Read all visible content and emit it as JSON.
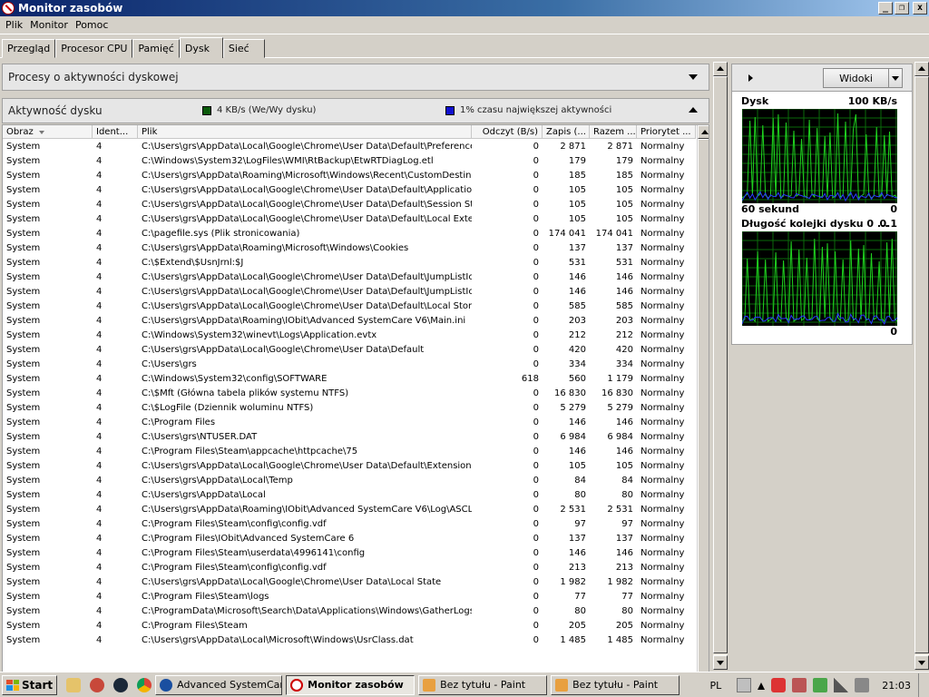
{
  "window": {
    "title": "Monitor zasobów",
    "controls": [
      "_",
      "❐",
      "x"
    ]
  },
  "menu": [
    "Plik",
    "Monitor",
    "Pomoc"
  ],
  "tabs": [
    {
      "label": "Przegląd",
      "active": false
    },
    {
      "label": "Procesor CPU",
      "active": false
    },
    {
      "label": "Pamięć",
      "active": false
    },
    {
      "label": "Dysk",
      "active": true
    },
    {
      "label": "Sieć",
      "active": false
    }
  ],
  "sections": {
    "processes": {
      "title": "Procesy o aktywności dyskowej"
    },
    "disk_activity": {
      "title": "Aktywność dysku",
      "legend_rw": {
        "text": "4 KB/s (We/Wy dysku)",
        "color": "#0a5a0a"
      },
      "legend_active": {
        "text": "1% czasu największej aktywności",
        "color": "#1010d0"
      }
    }
  },
  "table": {
    "columns": [
      "Obraz",
      "Ident...",
      "Plik",
      "Odczyt (B/s)",
      "Zapis (...",
      "Razem ...",
      "Priorytet ..."
    ],
    "rows": [
      [
        "System",
        "4",
        "C:\\Users\\grs\\AppData\\Local\\Google\\Chrome\\User Data\\Default\\Preferences",
        "0",
        "2 871",
        "2 871",
        "Normalny"
      ],
      [
        "System",
        "4",
        "C:\\Windows\\System32\\LogFiles\\WMI\\RtBackup\\EtwRTDiagLog.etl",
        "0",
        "179",
        "179",
        "Normalny"
      ],
      [
        "System",
        "4",
        "C:\\Users\\grs\\AppData\\Roaming\\Microsoft\\Windows\\Recent\\CustomDestinati...",
        "0",
        "185",
        "185",
        "Normalny"
      ],
      [
        "System",
        "4",
        "C:\\Users\\grs\\AppData\\Local\\Google\\Chrome\\User Data\\Default\\Application ...",
        "0",
        "105",
        "105",
        "Normalny"
      ],
      [
        "System",
        "4",
        "C:\\Users\\grs\\AppData\\Local\\Google\\Chrome\\User Data\\Default\\Session Stor...",
        "0",
        "105",
        "105",
        "Normalny"
      ],
      [
        "System",
        "4",
        "C:\\Users\\grs\\AppData\\Local\\Google\\Chrome\\User Data\\Default\\Local Extensi...",
        "0",
        "105",
        "105",
        "Normalny"
      ],
      [
        "System",
        "4",
        "C:\\pagefile.sys (Plik stronicowania)",
        "0",
        "174 041",
        "174 041",
        "Normalny"
      ],
      [
        "System",
        "4",
        "C:\\Users\\grs\\AppData\\Roaming\\Microsoft\\Windows\\Cookies",
        "0",
        "137",
        "137",
        "Normalny"
      ],
      [
        "System",
        "4",
        "C:\\$Extend\\$UsnJrnl:$J",
        "0",
        "531",
        "531",
        "Normalny"
      ],
      [
        "System",
        "4",
        "C:\\Users\\grs\\AppData\\Local\\Google\\Chrome\\User Data\\Default\\JumpListIcon...",
        "0",
        "146",
        "146",
        "Normalny"
      ],
      [
        "System",
        "4",
        "C:\\Users\\grs\\AppData\\Local\\Google\\Chrome\\User Data\\Default\\JumpListIcons",
        "0",
        "146",
        "146",
        "Normalny"
      ],
      [
        "System",
        "4",
        "C:\\Users\\grs\\AppData\\Local\\Google\\Chrome\\User Data\\Default\\Local Storage",
        "0",
        "585",
        "585",
        "Normalny"
      ],
      [
        "System",
        "4",
        "C:\\Users\\grs\\AppData\\Roaming\\IObit\\Advanced SystemCare V6\\Main.ini",
        "0",
        "203",
        "203",
        "Normalny"
      ],
      [
        "System",
        "4",
        "C:\\Windows\\System32\\winevt\\Logs\\Application.evtx",
        "0",
        "212",
        "212",
        "Normalny"
      ],
      [
        "System",
        "4",
        "C:\\Users\\grs\\AppData\\Local\\Google\\Chrome\\User Data\\Default",
        "0",
        "420",
        "420",
        "Normalny"
      ],
      [
        "System",
        "4",
        "C:\\Users\\grs",
        "0",
        "334",
        "334",
        "Normalny"
      ],
      [
        "System",
        "4",
        "C:\\Windows\\System32\\config\\SOFTWARE",
        "618",
        "560",
        "1 179",
        "Normalny"
      ],
      [
        "System",
        "4",
        "C:\\$Mft (Główna tabela plików systemu NTFS)",
        "0",
        "16 830",
        "16 830",
        "Normalny"
      ],
      [
        "System",
        "4",
        "C:\\$LogFile (Dziennik woluminu NTFS)",
        "0",
        "5 279",
        "5 279",
        "Normalny"
      ],
      [
        "System",
        "4",
        "C:\\Program Files",
        "0",
        "146",
        "146",
        "Normalny"
      ],
      [
        "System",
        "4",
        "C:\\Users\\grs\\NTUSER.DAT",
        "0",
        "6 984",
        "6 984",
        "Normalny"
      ],
      [
        "System",
        "4",
        "C:\\Program Files\\Steam\\appcache\\httpcache\\75",
        "0",
        "146",
        "146",
        "Normalny"
      ],
      [
        "System",
        "4",
        "C:\\Users\\grs\\AppData\\Local\\Google\\Chrome\\User Data\\Default\\Extension State",
        "0",
        "105",
        "105",
        "Normalny"
      ],
      [
        "System",
        "4",
        "C:\\Users\\grs\\AppData\\Local\\Temp",
        "0",
        "84",
        "84",
        "Normalny"
      ],
      [
        "System",
        "4",
        "C:\\Users\\grs\\AppData\\Local",
        "0",
        "80",
        "80",
        "Normalny"
      ],
      [
        "System",
        "4",
        "C:\\Users\\grs\\AppData\\Roaming\\IObit\\Advanced SystemCare V6\\Log\\ASCLo...",
        "0",
        "2 531",
        "2 531",
        "Normalny"
      ],
      [
        "System",
        "4",
        "C:\\Program Files\\Steam\\config\\config.vdf",
        "0",
        "97",
        "97",
        "Normalny"
      ],
      [
        "System",
        "4",
        "C:\\Program Files\\IObit\\Advanced SystemCare 6",
        "0",
        "137",
        "137",
        "Normalny"
      ],
      [
        "System",
        "4",
        "C:\\Program Files\\Steam\\userdata\\4996141\\config",
        "0",
        "146",
        "146",
        "Normalny"
      ],
      [
        "System",
        "4",
        "C:\\Program Files\\Steam\\config\\config.vdf",
        "0",
        "213",
        "213",
        "Normalny"
      ],
      [
        "System",
        "4",
        "C:\\Users\\grs\\AppData\\Local\\Google\\Chrome\\User Data\\Local State",
        "0",
        "1 982",
        "1 982",
        "Normalny"
      ],
      [
        "System",
        "4",
        "C:\\Program Files\\Steam\\logs",
        "0",
        "77",
        "77",
        "Normalny"
      ],
      [
        "System",
        "4",
        "C:\\ProgramData\\Microsoft\\Search\\Data\\Applications\\Windows\\GatherLogs\\S...",
        "0",
        "80",
        "80",
        "Normalny"
      ],
      [
        "System",
        "4",
        "C:\\Program Files\\Steam",
        "0",
        "205",
        "205",
        "Normalny"
      ],
      [
        "System",
        "4",
        "C:\\Users\\grs\\AppData\\Local\\Microsoft\\Windows\\UsrClass.dat",
        "0",
        "1 485",
        "1 485",
        "Normalny"
      ]
    ]
  },
  "right_pane": {
    "views_button": "Widoki",
    "graph1": {
      "title": "Dysk",
      "max_label": "100 KB/s",
      "x_label": "60 sekund",
      "min_label": "0"
    },
    "graph2": {
      "title": "Długość kolejki dysku 0 ...",
      "max_label": "0.1",
      "min_label": "0"
    },
    "colors": {
      "background": "#000000",
      "grid": "#0a6a0a",
      "primary": "#1fd21f",
      "secondary": "#2a3aff"
    }
  },
  "taskbar": {
    "start": "Start",
    "buttons": [
      {
        "label": "Advanced SystemCare",
        "active": false,
        "icon": "advanced-systemcare-icon"
      },
      {
        "label": "Monitor zasobów",
        "active": true,
        "icon": "resource-monitor-icon"
      },
      {
        "label": "Bez tytułu - Paint",
        "active": false,
        "icon": "paint-icon"
      },
      {
        "label": "Bez tytułu - Paint",
        "active": false,
        "icon": "paint-icon"
      }
    ],
    "lang": "PL",
    "clock": "21:03"
  }
}
